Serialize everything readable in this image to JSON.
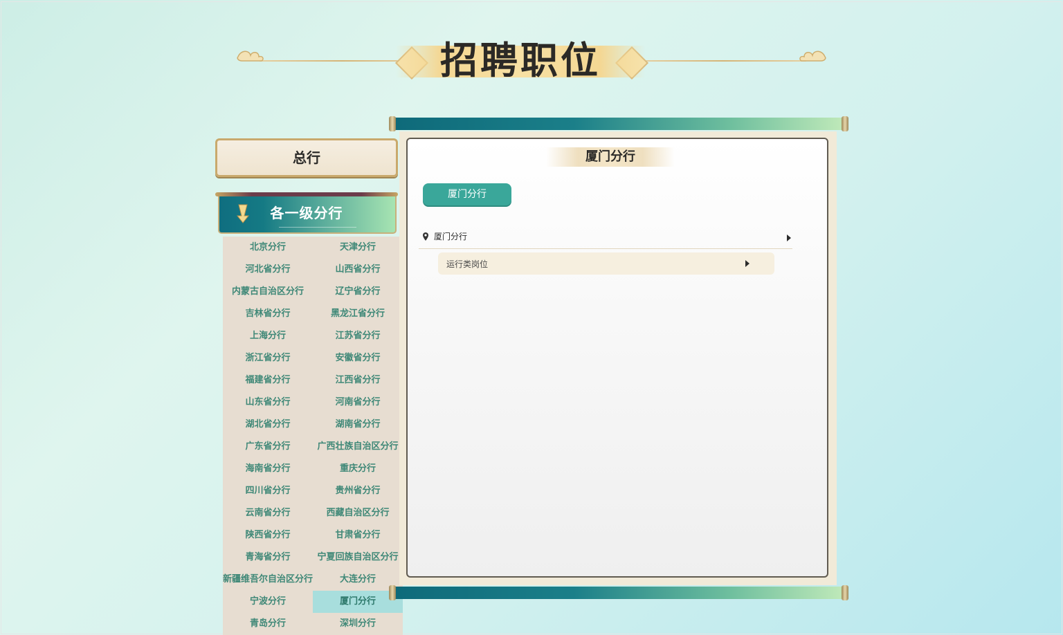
{
  "header": {
    "title": "招聘职位"
  },
  "sidebar": {
    "hq_label": "总行",
    "branches_header": "各一级分行",
    "branches": [
      "北京分行",
      "天津分行",
      "河北省分行",
      "山西省分行",
      "内蒙古自治区分行",
      "辽宁省分行",
      "吉林省分行",
      "黑龙江省分行",
      "上海分行",
      "江苏省分行",
      "浙江省分行",
      "安徽省分行",
      "福建省分行",
      "江西省分行",
      "山东省分行",
      "河南省分行",
      "湖北省分行",
      "湖南省分行",
      "广东省分行",
      "广西壮族自治区分行",
      "海南省分行",
      "重庆分行",
      "四川省分行",
      "贵州省分行",
      "云南省分行",
      "西藏自治区分行",
      "陕西省分行",
      "甘肃省分行",
      "青海省分行",
      "宁夏回族自治区分行",
      "新疆维吾尔自治区分行",
      "大连分行",
      "宁波分行",
      "厦门分行",
      "青岛分行",
      "深圳分行"
    ],
    "active_branch": "厦门分行"
  },
  "panel": {
    "title": "厦门分行",
    "tab_label": "厦门分行",
    "location_label": "厦门分行",
    "category_label": "运行类岗位"
  },
  "colors": {
    "accent_teal": "#3aa79a",
    "branch_text": "#3f8877",
    "active_bg": "#a8dedd"
  },
  "icons": {
    "location": "map-pin-icon",
    "expand": "caret-right-icon",
    "branch_header": "down-arrow-icon"
  }
}
